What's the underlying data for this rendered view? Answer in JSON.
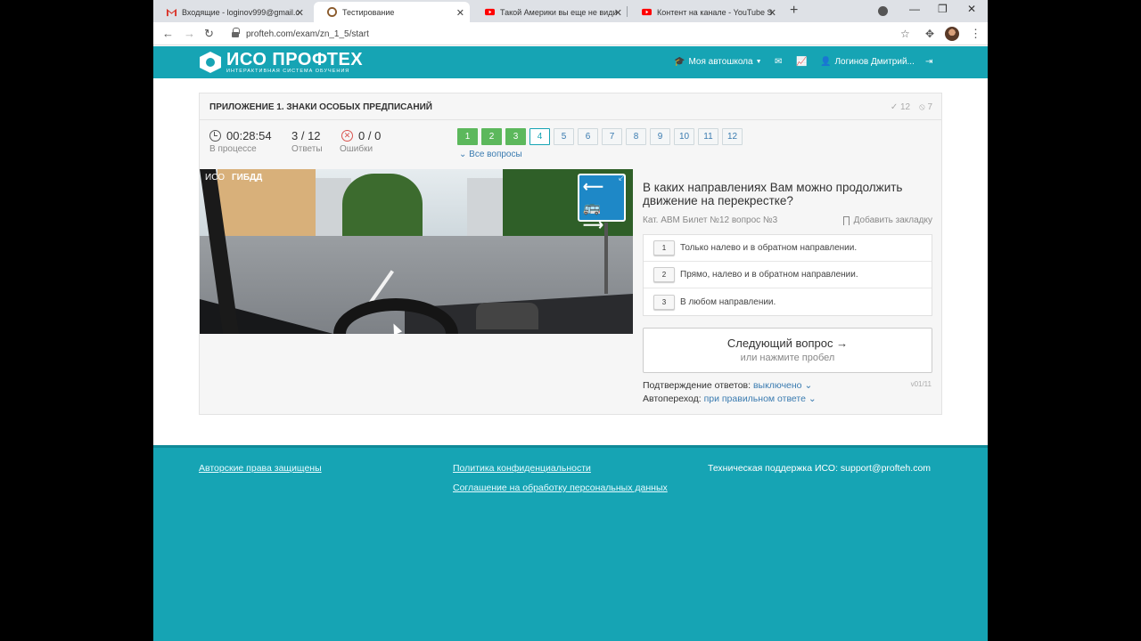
{
  "browser": {
    "tabs": [
      {
        "title": "Входящие - loginov999@gmail.c",
        "icon": "gmail-icon"
      },
      {
        "title": "Тестирование",
        "icon": "site-icon",
        "active": true
      },
      {
        "title": "Такой Америки вы еще не види",
        "icon": "youtube-icon"
      },
      {
        "title": "Контент на канале - YouTube St",
        "icon": "youtube-icon"
      }
    ],
    "url": "profteh.com/exam/zn_1_5/start"
  },
  "header": {
    "logo_title": "ИСО ПРОФТЕХ",
    "logo_subtitle": "ИНТЕРАКТИВНАЯ СИСТЕМА ОБУЧЕНИЯ",
    "school_label": "Моя автошкола",
    "user_label": "Логинов Дмитрий..."
  },
  "panel": {
    "title": "ПРИЛОЖЕНИЕ 1. ЗНАКИ ОСОБЫХ ПРЕДПИСАНИЙ",
    "stat_correct": "12",
    "stat_skip": "7",
    "timer": "00:28:54",
    "timer_label": "В процессе",
    "answered": "3 / 12",
    "answered_label": "Ответы",
    "errors": "0 / 0",
    "errors_label": "Ошибки",
    "question_numbers": [
      "1",
      "2",
      "3",
      "4",
      "5",
      "6",
      "7",
      "8",
      "9",
      "10",
      "11",
      "12"
    ],
    "all_questions": "Все вопросы"
  },
  "photo": {
    "badge_iso": "ИСО",
    "badge_gibdd": "ГИБДД"
  },
  "question": {
    "text": "В каких направлениях Вам можно продолжить движение на перекрестке?",
    "meta": "Кат. ABM  Билет №12  вопрос №3",
    "bookmark": "Добавить закладку",
    "answers": [
      {
        "num": "1",
        "text": "Только налево и в обратном направлении."
      },
      {
        "num": "2",
        "text": "Прямо, налево и в обратном направлении."
      },
      {
        "num": "3",
        "text": "В любом направлении."
      }
    ],
    "next_label": "Следующий вопрос →",
    "next_hint": "или нажмите пробел",
    "version": "v01/11",
    "confirm_label": "Подтверждение ответов:",
    "confirm_value": "выключено",
    "auto_label": "Автопереход:",
    "auto_value": "при правильном ответе"
  },
  "footer": {
    "copyright": "Авторские права защищены",
    "privacy": "Политика конфиденциальности",
    "agreement": "Соглашение на обработку персональных данных",
    "support": "Техническая поддержка ИСО:  support@profteh.com"
  },
  "colors": {
    "brand": "#16a4b4",
    "done": "#5cb85c",
    "link": "#3a7bb0"
  }
}
